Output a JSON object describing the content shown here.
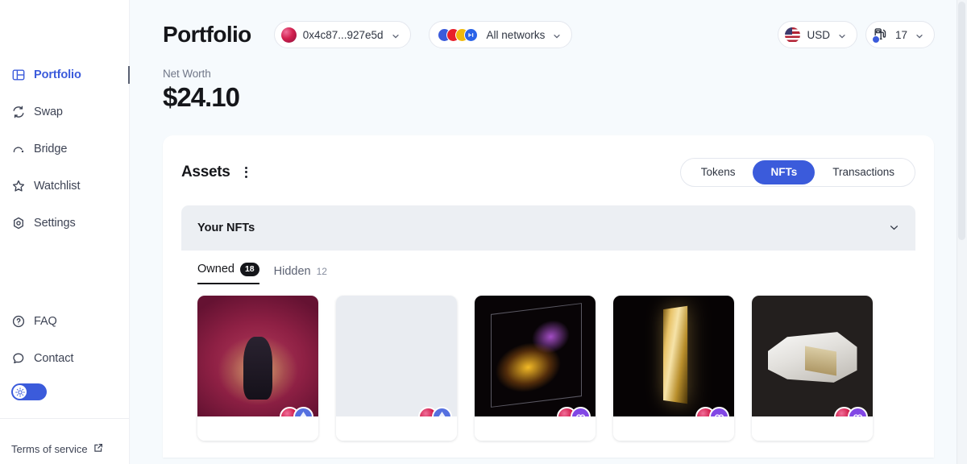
{
  "sidebar": {
    "items": [
      {
        "label": "Portfolio",
        "icon": "portfolio-icon",
        "active": true
      },
      {
        "label": "Swap",
        "icon": "swap-icon",
        "active": false
      },
      {
        "label": "Bridge",
        "icon": "bridge-icon",
        "active": false
      },
      {
        "label": "Watchlist",
        "icon": "star-icon",
        "active": false
      },
      {
        "label": "Settings",
        "icon": "gear-icon",
        "active": false
      }
    ],
    "bottom_items": [
      {
        "label": "FAQ",
        "icon": "question-circle-icon"
      },
      {
        "label": "Contact",
        "icon": "chat-bubble-icon"
      }
    ],
    "theme_toggle": {
      "state": "on",
      "icon": "sun-icon"
    },
    "terms": {
      "label": "Terms of service",
      "icon": "external-link-icon"
    }
  },
  "header": {
    "title": "Portfolio",
    "address_pill": {
      "label": "0x4c87...927e5d",
      "avatar": "wallet-avatar",
      "chevron": "chevron-down-icon"
    },
    "network_pill": {
      "label": "All networks",
      "chevron": "chevron-down-icon",
      "networks": [
        "ethereum",
        "optimism",
        "binance",
        "base"
      ]
    },
    "currency_pill": {
      "label": "USD",
      "flag": "us-flag-icon",
      "chevron": "chevron-down-icon"
    },
    "gas_pill": {
      "label": "17",
      "icon": "gas-pump-icon",
      "chevron": "chevron-down-icon"
    }
  },
  "net_worth": {
    "label": "Net Worth",
    "value": "$24.10"
  },
  "assets": {
    "title": "Assets",
    "menu_icon": "kebab-menu-icon",
    "tabs": [
      {
        "label": "Tokens",
        "active": false
      },
      {
        "label": "NFTs",
        "active": true
      },
      {
        "label": "Transactions",
        "active": false
      }
    ]
  },
  "nfts": {
    "section_title": "Your NFTs",
    "collapse_icon": "chevron-down-icon",
    "filters": [
      {
        "label": "Owned",
        "count": "18",
        "active": true
      },
      {
        "label": "Hidden",
        "count": "12",
        "active": false
      }
    ],
    "cards": [
      {
        "art": "art-throne",
        "chains": [
          "nft-collection",
          "ethereum"
        ]
      },
      {
        "art": "art-empty",
        "chains": [
          "nft-collection",
          "ethereum"
        ]
      },
      {
        "art": "art-neon",
        "chains": [
          "nft-collection",
          "polygon"
        ]
      },
      {
        "art": "art-gold",
        "chains": [
          "nft-collection",
          "polygon"
        ]
      },
      {
        "art": "art-room",
        "chains": [
          "nft-collection",
          "polygon"
        ]
      }
    ]
  },
  "colors": {
    "accent": "#3b5bdb",
    "polygon": "#8247e5",
    "ethereum": "#5570e0",
    "page_bg": "#f6fafd",
    "text": "#15161a"
  }
}
